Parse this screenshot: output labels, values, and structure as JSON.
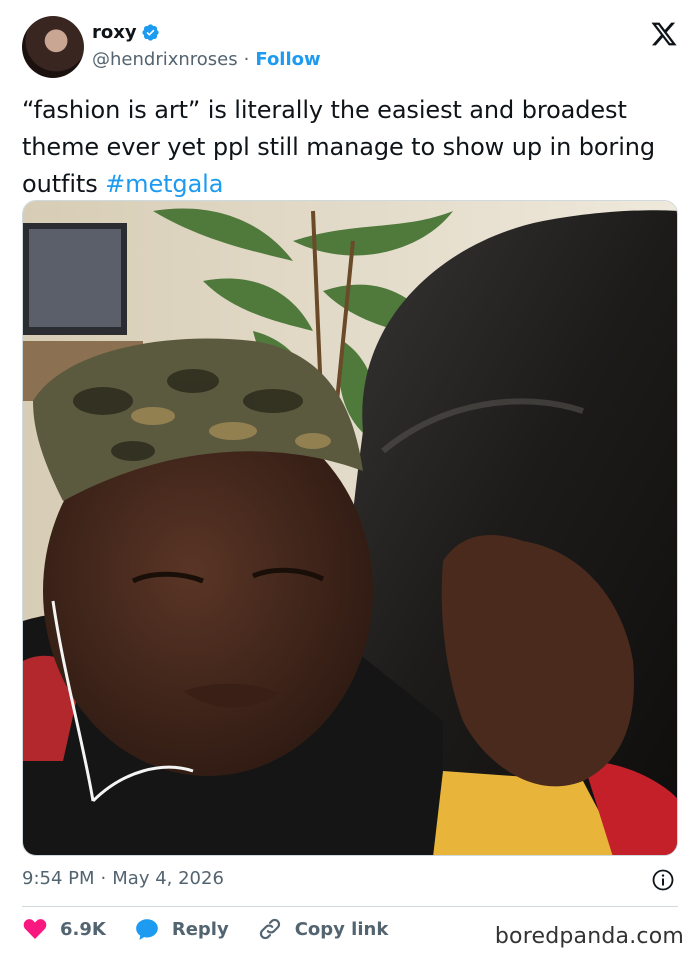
{
  "author": {
    "name": "roxy",
    "handle": "@hendrixnroses",
    "separator": "·",
    "follow_label": "Follow",
    "verified_icon": "verified-badge-icon"
  },
  "tweet": {
    "text": "“fashion is art” is literally the easiest and broadest theme ever yet ppl still manage to show up in boring outfits ",
    "hashtag": "#metgala"
  },
  "meta": {
    "time": "9:54 PM",
    "separator": "·",
    "date": "May 4, 2026"
  },
  "actions": {
    "likes": "6.9K",
    "reply_label": "Reply",
    "copy_label": "Copy link"
  },
  "watermark": "boredpanda.com",
  "colors": {
    "accent": "#1d9bf0",
    "like": "#f91880",
    "text": "#0f1419",
    "muted": "#536471"
  }
}
